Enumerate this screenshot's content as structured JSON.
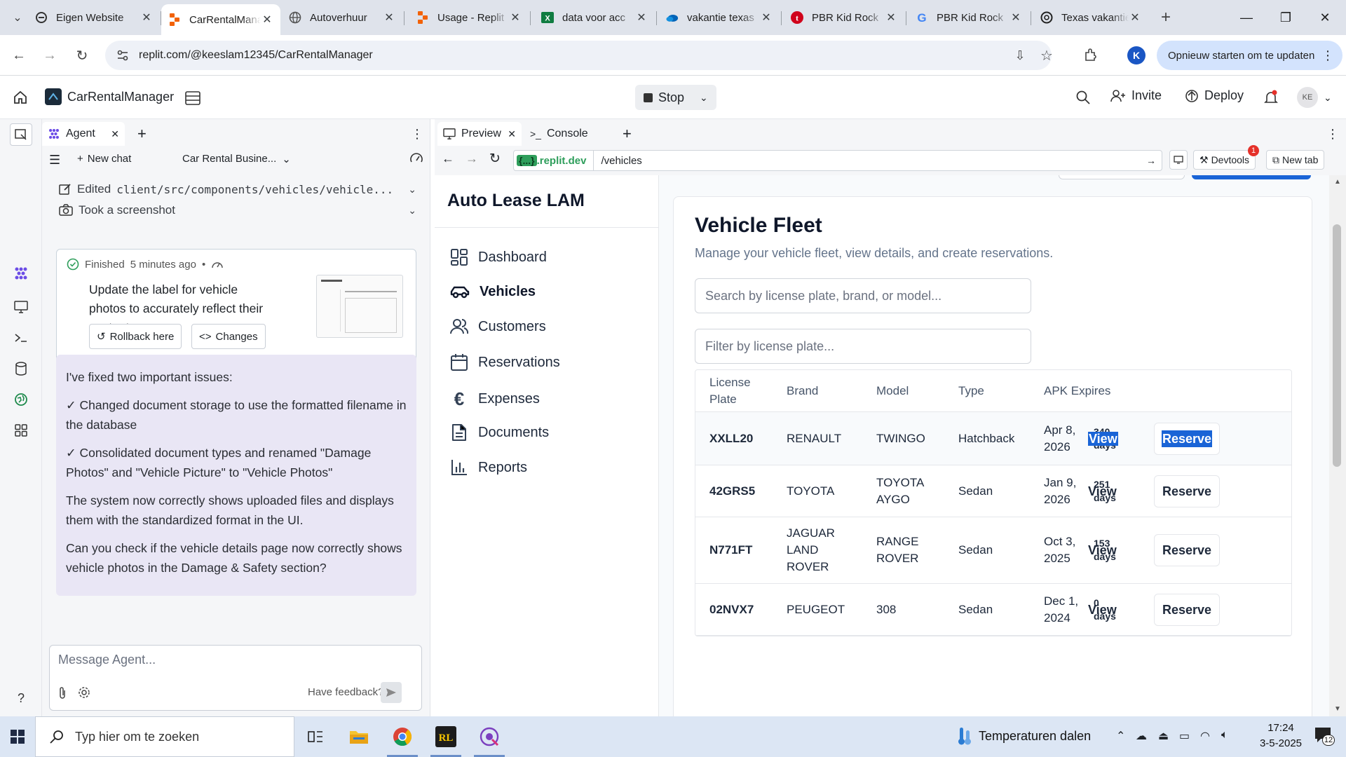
{
  "browser": {
    "tabs": [
      {
        "title": "Eigen Website",
        "icon": "replit-like-icon"
      },
      {
        "title": "CarRentalManager",
        "icon": "replit-icon"
      },
      {
        "title": "Autoverhuur",
        "icon": "globe-icon"
      },
      {
        "title": "Usage - Replit",
        "icon": "replit-icon"
      },
      {
        "title": "data voor acc",
        "icon": "excel-icon"
      },
      {
        "title": "vakantie texas",
        "icon": "onedrive-icon"
      },
      {
        "title": "PBR Kid Rock",
        "icon": "tumblr-icon"
      },
      {
        "title": "PBR Kid Rock",
        "icon": "google-icon"
      },
      {
        "title": "Texas vakantie",
        "icon": "openai-icon"
      }
    ],
    "url": "replit.com/@keeslam12345/CarRentalManager",
    "update_button": "Opnieuw starten om te updaten",
    "profile_initial": "K"
  },
  "replit": {
    "project_name": "CarRentalManager",
    "stop_label": "Stop",
    "invite_label": "Invite",
    "deploy_label": "Deploy",
    "avatar_initials": "KE"
  },
  "agent": {
    "tab_label": "Agent",
    "new_chat_label": "New chat",
    "chat_title": "Car Rental Busine...",
    "edited_prefix": "Edited",
    "edited_file": "client/src/components/vehicles/vehicle...",
    "screenshot_label": "Took a screenshot",
    "finished_label": "Finished",
    "finished_time": "5 minutes ago",
    "finished_bullet": "•",
    "finished_text": "Update the label for vehicle photos to accurately reflect their content",
    "rollback_label": "Rollback here",
    "changes_label": "Changes",
    "message": {
      "p1": "I've fixed two important issues:",
      "p2": "✓ Changed document storage to use the formatted filename in the database",
      "p3": "✓ Consolidated document types and renamed \"Damage Photos\" and \"Vehicle Picture\" to \"Vehicle Photos\"",
      "p4": "The system now correctly shows uploaded files and displays them with the standardized format in the UI.",
      "p5": "Can you check if the vehicle details page now correctly shows vehicle photos in the Damage & Safety section?"
    },
    "input_placeholder": "Message Agent...",
    "feedback_label": "Have feedback?"
  },
  "preview": {
    "tab_preview": "Preview",
    "tab_console": "Console",
    "domain_chip": "{...}",
    "domain_suffix": ".replit.dev",
    "path": "/vehicles",
    "devtools_label": "Devtools",
    "devtools_badge": "1",
    "new_tab_label": "New tab"
  },
  "site": {
    "brand": "Auto Lease LAM",
    "nav": [
      {
        "label": "Dashboard",
        "icon": "dashboard-icon"
      },
      {
        "label": "Vehicles",
        "icon": "car-icon"
      },
      {
        "label": "Customers",
        "icon": "users-icon"
      },
      {
        "label": "Reservations",
        "icon": "calendar-icon"
      },
      {
        "label": "Expenses",
        "icon": "euro-icon"
      },
      {
        "label": "Documents",
        "icon": "document-icon"
      },
      {
        "label": "Reports",
        "icon": "bar-chart-icon"
      }
    ],
    "heading": "Vehicle Fleet",
    "subheading": "Manage your vehicle fleet, view details, and create reservations.",
    "search_placeholder": "Search by license plate, brand, or model...",
    "filter_placeholder": "Filter by license plate...",
    "columns": {
      "plate": "License Plate",
      "brand": "Brand",
      "model": "Model",
      "type": "Type",
      "apk": "APK Expires"
    },
    "rows": [
      {
        "plate": "XXLL20",
        "brand": "RENAULT",
        "model": "TWINGO",
        "type": "Hatchback",
        "apk": "Apr 8, 2026",
        "days": "340 days",
        "view": "View",
        "reserve": "Reserve"
      },
      {
        "plate": "42GRS5",
        "brand": "TOYOTA",
        "model": "TOYOTA AYGO",
        "type": "Sedan",
        "apk": "Jan 9, 2026",
        "days": "251 days",
        "view": "View",
        "reserve": "Reserve"
      },
      {
        "plate": "N771FT",
        "brand": "JAGUAR LAND ROVER",
        "model": "RANGE ROVER",
        "type": "Sedan",
        "apk": "Oct 3, 2025",
        "days": "153 days",
        "view": "View",
        "reserve": "Reserve"
      },
      {
        "plate": "02NVX7",
        "brand": "PEUGEOT",
        "model": "308",
        "type": "Sedan",
        "apk": "Dec 1, 2024",
        "days": "0 days",
        "view": "View",
        "reserve": "Reserve"
      }
    ]
  },
  "taskbar": {
    "search_placeholder": "Typ hier om te zoeken",
    "weather_text": "Temperaturen dalen",
    "time": "17:24",
    "date": "3-5-2025",
    "notification_count": "12"
  },
  "colors": {
    "accent": "#1a64d6",
    "agent_message_bg": "#e9e6f5",
    "replit_orange": "#f26207",
    "success_green": "#2e9e5b"
  }
}
